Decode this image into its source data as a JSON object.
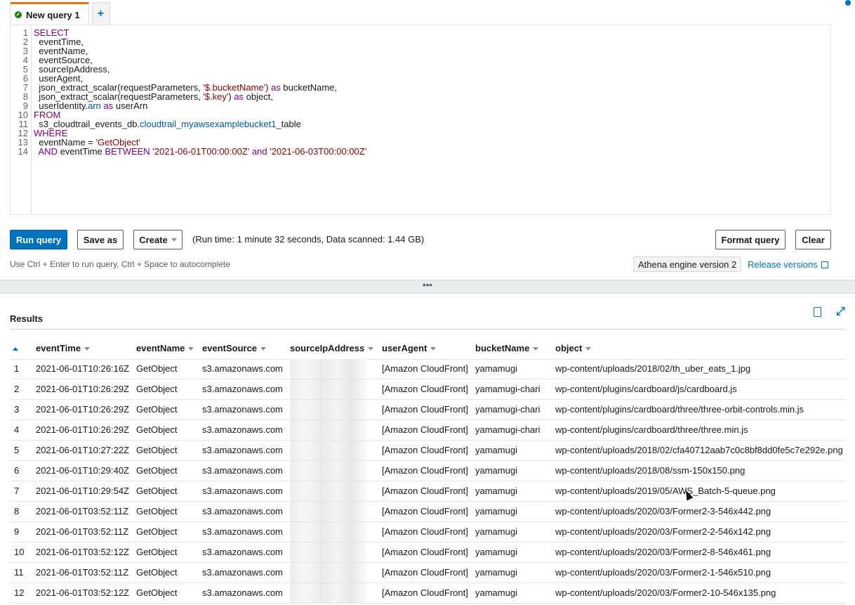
{
  "tabs": [
    {
      "label": "New query 1",
      "status": "success"
    }
  ],
  "add_tab_label": "+",
  "editor": {
    "lines": [
      {
        "n": "1",
        "parts": [
          {
            "t": "SELECT",
            "c": "kw"
          }
        ]
      },
      {
        "n": "2",
        "parts": [
          {
            "t": "  eventTime,",
            "c": ""
          }
        ]
      },
      {
        "n": "3",
        "parts": [
          {
            "t": "  eventName,",
            "c": ""
          }
        ]
      },
      {
        "n": "4",
        "parts": [
          {
            "t": "  eventSource,",
            "c": ""
          }
        ]
      },
      {
        "n": "5",
        "parts": [
          {
            "t": "  sourceIpAddress,",
            "c": ""
          }
        ]
      },
      {
        "n": "6",
        "parts": [
          {
            "t": "  userAgent,",
            "c": ""
          }
        ]
      },
      {
        "n": "7",
        "parts": [
          {
            "t": "  json_extract_scalar(requestParameters, ",
            "c": ""
          },
          {
            "t": "'$.bucketName'",
            "c": "str"
          },
          {
            "t": ") ",
            "c": ""
          },
          {
            "t": "as",
            "c": "kw"
          },
          {
            "t": " bucketName,",
            "c": ""
          }
        ]
      },
      {
        "n": "8",
        "parts": [
          {
            "t": "  json_extract_scalar(requestParameters, ",
            "c": ""
          },
          {
            "t": "'$.key'",
            "c": "str"
          },
          {
            "t": ") ",
            "c": ""
          },
          {
            "t": "as",
            "c": "kw"
          },
          {
            "t": " object,",
            "c": ""
          }
        ]
      },
      {
        "n": "9",
        "parts": [
          {
            "t": "  userIdentity.",
            "c": ""
          },
          {
            "t": "arn",
            "c": "fld"
          },
          {
            "t": " ",
            "c": ""
          },
          {
            "t": "as",
            "c": "kw"
          },
          {
            "t": " userArn",
            "c": ""
          }
        ]
      },
      {
        "n": "10",
        "parts": [
          {
            "t": "FROM",
            "c": "kw"
          }
        ]
      },
      {
        "n": "11",
        "parts": [
          {
            "t": "  s3_cloudtrail_events_db.",
            "c": ""
          },
          {
            "t": "cloudtrail_myawsexamplebucket1",
            "c": "fld"
          },
          {
            "t": "_table",
            "c": ""
          }
        ]
      },
      {
        "n": "12",
        "parts": [
          {
            "t": "WHERE",
            "c": "kw"
          }
        ]
      },
      {
        "n": "13",
        "parts": [
          {
            "t": "  eventName = ",
            "c": ""
          },
          {
            "t": "'GetObject'",
            "c": "str"
          }
        ]
      },
      {
        "n": "14",
        "parts": [
          {
            "t": "  ",
            "c": ""
          },
          {
            "t": "AND",
            "c": "kw"
          },
          {
            "t": " eventTime ",
            "c": ""
          },
          {
            "t": "BETWEEN",
            "c": "kw"
          },
          {
            "t": " ",
            "c": ""
          },
          {
            "t": "'2021-06-01T00:00:00Z'",
            "c": "str"
          },
          {
            "t": " ",
            "c": ""
          },
          {
            "t": "and",
            "c": "kw"
          },
          {
            "t": " ",
            "c": ""
          },
          {
            "t": "'2021-06-03T00:00:00Z'",
            "c": "str"
          }
        ]
      }
    ]
  },
  "toolbar": {
    "run_label": "Run query",
    "save_label": "Save as",
    "create_label": "Create",
    "run_info": "(Run time: 1 minute 32 seconds, Data scanned: 1.44 GB)",
    "format_label": "Format query",
    "clear_label": "Clear"
  },
  "hint": "Use Ctrl + Enter to run query, Ctrl + Space to autocomplete",
  "engine_label": "Athena engine version 2",
  "release_label": "Release versions",
  "splitter_label": "•••",
  "results": {
    "title": "Results",
    "columns": [
      "eventTime",
      "eventName",
      "eventSource",
      "sourceIpAddress",
      "userAgent",
      "bucketName",
      "object"
    ],
    "rows": [
      [
        "1",
        "2021-06-01T10:26:16Z",
        "GetObject",
        "s3.amazonaws.com",
        "[Amazon CloudFront]",
        "yamamugi",
        "wp-content/uploads/2018/02/th_uber_eats_1.jpg"
      ],
      [
        "2",
        "2021-06-01T10:26:29Z",
        "GetObject",
        "s3.amazonaws.com",
        "[Amazon CloudFront]",
        "yamamugi-chari",
        "wp-content/plugins/cardboard/js/cardboard.js"
      ],
      [
        "3",
        "2021-06-01T10:26:29Z",
        "GetObject",
        "s3.amazonaws.com",
        "[Amazon CloudFront]",
        "yamamugi-chari",
        "wp-content/plugins/cardboard/three/three-orbit-controls.min.js"
      ],
      [
        "4",
        "2021-06-01T10:26:29Z",
        "GetObject",
        "s3.amazonaws.com",
        "[Amazon CloudFront]",
        "yamamugi-chari",
        "wp-content/plugins/cardboard/three/three.min.js"
      ],
      [
        "5",
        "2021-06-01T10:27:22Z",
        "GetObject",
        "s3.amazonaws.com",
        "[Amazon CloudFront]",
        "yamamugi",
        "wp-content/uploads/2018/02/cfa40712aab7c0c8bf8dd0fe5c7e292e.png"
      ],
      [
        "6",
        "2021-06-01T10:29:40Z",
        "GetObject",
        "s3.amazonaws.com",
        "[Amazon CloudFront]",
        "yamamugi",
        "wp-content/uploads/2018/08/ssm-150x150.png"
      ],
      [
        "7",
        "2021-06-01T10:29:54Z",
        "GetObject",
        "s3.amazonaws.com",
        "[Amazon CloudFront]",
        "yamamugi",
        "wp-content/uploads/2019/05/AWS_Batch-5-queue.png"
      ],
      [
        "8",
        "2021-06-01T03:52:11Z",
        "GetObject",
        "s3.amazonaws.com",
        "[Amazon CloudFront]",
        "yamamugi",
        "wp-content/uploads/2020/03/Former2-3-546x442.png"
      ],
      [
        "9",
        "2021-06-01T03:52:11Z",
        "GetObject",
        "s3.amazonaws.com",
        "[Amazon CloudFront]",
        "yamamugi",
        "wp-content/uploads/2020/03/Former2-2-546x142.png"
      ],
      [
        "10",
        "2021-06-01T03:52:12Z",
        "GetObject",
        "s3.amazonaws.com",
        "[Amazon CloudFront]",
        "yamamugi",
        "wp-content/uploads/2020/03/Former2-8-546x461.png"
      ],
      [
        "11",
        "2021-06-01T03:52:11Z",
        "GetObject",
        "s3.amazonaws.com",
        "[Amazon CloudFront]",
        "yamamugi",
        "wp-content/uploads/2020/03/Former2-1-546x510.png"
      ],
      [
        "12",
        "2021-06-01T03:52:12Z",
        "GetObject",
        "s3.amazonaws.com",
        "[Amazon CloudFront]",
        "yamamugi",
        "wp-content/uploads/2020/03/Former2-10-546x135.png"
      ]
    ]
  },
  "icons": {
    "tab_status": "check-circle-icon",
    "info": "info-icon",
    "release": "external-link-icon",
    "download": "download-icon",
    "expand": "expand-icon",
    "sort": "sort-ascending-icon"
  },
  "colors": {
    "primary": "#0073bb",
    "tab_accent": "#ec7211",
    "success": "#1d8102",
    "keyword": "#800080",
    "string": "#8b0000"
  }
}
